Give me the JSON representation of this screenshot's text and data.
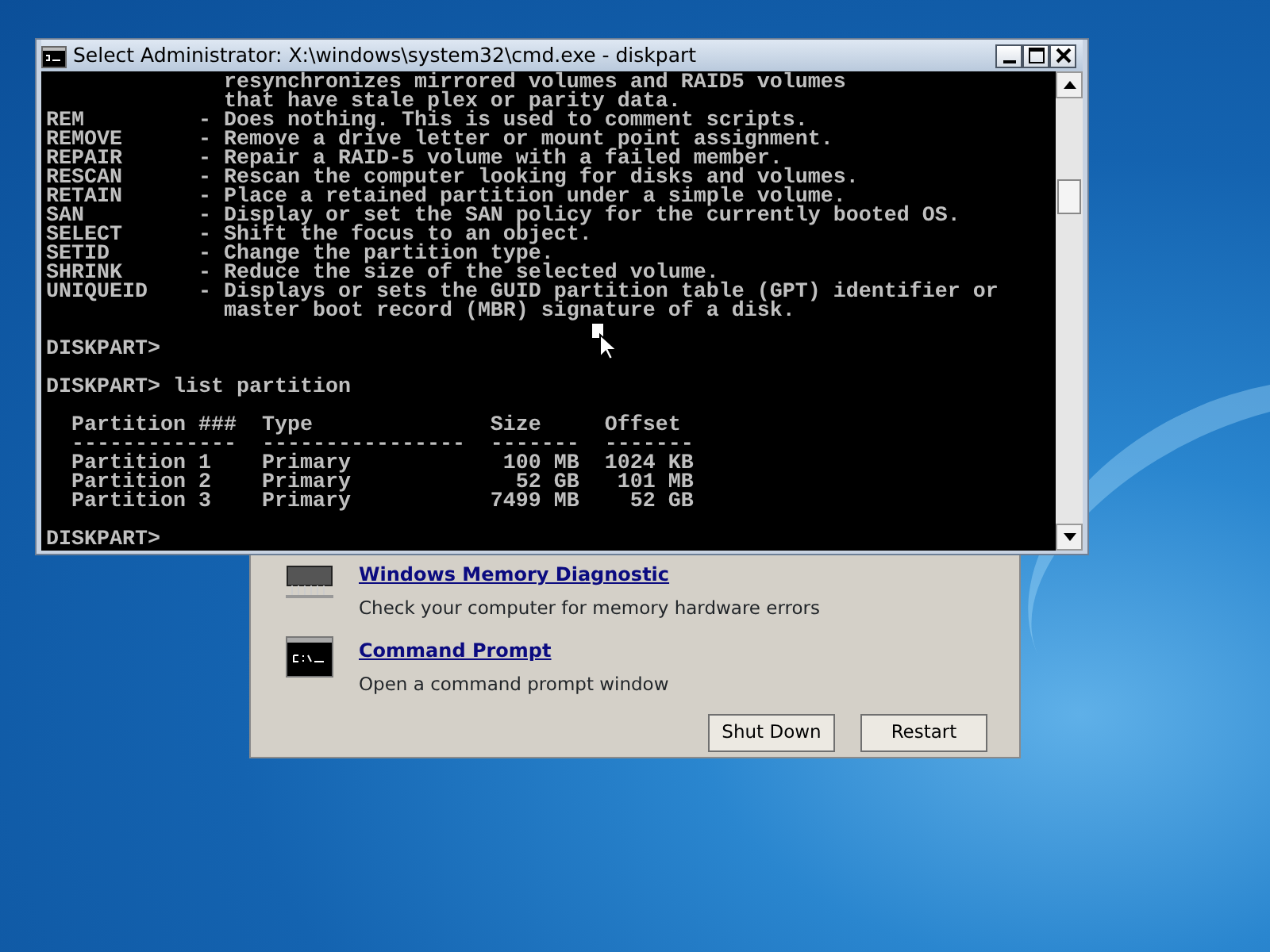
{
  "console_window": {
    "title": "Select Administrator: X:\\windows\\system32\\cmd.exe - diskpart",
    "lines": [
      {
        "kind": "text",
        "text": "              resynchronizes mirrored volumes and RAID5 volumes"
      },
      {
        "kind": "text",
        "text": "              that have stale plex or parity data."
      },
      {
        "kind": "text",
        "text": "REM         - Does nothing. This is used to comment scripts."
      },
      {
        "kind": "text",
        "text": "REMOVE      - Remove a drive letter or mount point assignment."
      },
      {
        "kind": "text",
        "text": "REPAIR      - Repair a RAID-5 volume with a failed member."
      },
      {
        "kind": "text",
        "text": "RESCAN      - Rescan the computer looking for disks and volumes."
      },
      {
        "kind": "text",
        "text": "RETAIN      - Place a retained partition under a simple volume."
      },
      {
        "kind": "text",
        "text": "SAN         - Display or set the SAN policy for the currently booted OS."
      },
      {
        "kind": "text",
        "text": "SELECT      - Shift the focus to an object."
      },
      {
        "kind": "text",
        "text": "SETID       - Change the partition type."
      },
      {
        "kind": "text",
        "text": "SHRINK      - Reduce the size of the selected volume."
      },
      {
        "kind": "text",
        "text": "UNIQUEID    - Displays or sets the GUID partition table (GPT) identifier or"
      },
      {
        "kind": "text",
        "text": "              master boot record (MBR) signature of a disk."
      },
      {
        "kind": "blank"
      },
      {
        "kind": "text",
        "text": "DISKPART>"
      },
      {
        "kind": "blank"
      },
      {
        "kind": "text",
        "text": "DISKPART> list partition"
      },
      {
        "kind": "blank"
      },
      {
        "kind": "text",
        "text": "  Partition ###  Type              Size     Offset"
      },
      {
        "kind": "text",
        "text": "  -------------  ----------------  -------  -------"
      },
      {
        "kind": "text",
        "text": "  Partition 1    Primary            100 MB  1024 KB"
      },
      {
        "kind": "text",
        "text": "  Partition 2    Primary             52 GB   101 MB"
      },
      {
        "kind": "text",
        "text": "  Partition 3    Primary           7499 MB    52 GB"
      },
      {
        "kind": "blank"
      },
      {
        "kind": "text",
        "text": "DISKPART>"
      }
    ]
  },
  "recovery_dialog": {
    "items": [
      {
        "kind": "memory",
        "title": "Windows Memory Diagnostic",
        "description": "Check your computer for memory hardware errors"
      },
      {
        "kind": "console",
        "title": "Command Prompt",
        "description": "Open a command prompt window"
      }
    ],
    "buttons": [
      "Shut Down",
      "Restart"
    ]
  }
}
